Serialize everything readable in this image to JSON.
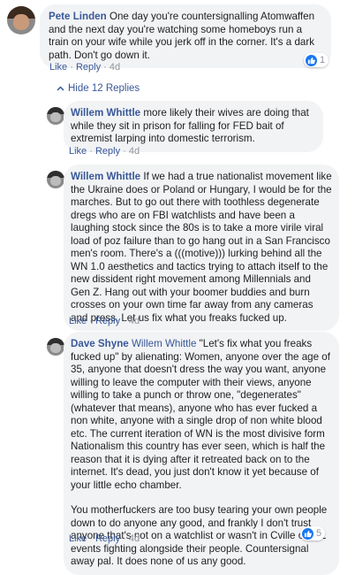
{
  "comments": [
    {
      "name": "Pete Linden",
      "text": "One day you're countersignalling Atomwaffen and the next day you're watching some homeboys run a train on your wife while you jerk off in the corner. It's a dark path. Don't go down it.",
      "like": "Like",
      "reply": "Reply",
      "time": "4d",
      "reactions": "1"
    },
    {
      "name": "Willem Whittle",
      "text": "more likely their wives are doing that while they sit in prison for falling for FED bait of extremist larping into domestic terrorism.",
      "like": "Like",
      "reply": "Reply",
      "time": "4d"
    },
    {
      "name": "Willem Whittle",
      "text": "If we had a true nationalist movement like the Ukraine does or Poland or Hungary, I would be for the marches. But to go out there with toothless degenerate dregs who are on FBI watchlists and have been a laughing stock since the 80s is to take a more virile viral load of poz failure than to go hang out in a San Francisco men's room. There's a (((motive))) lurking behind all the WN 1.0 aesthetics and tactics trying to attach itself to the new dissident right movement among Millennials and Gen Z. Hang out with your boomer buddies and burn crosses on your own time far away from any cameras and press. Let us fix what you freaks fucked up.",
      "like": "Like",
      "reply": "Reply",
      "time": "4d"
    },
    {
      "name": "Dave Shyne",
      "mention": "Willem Whittle",
      "text": "\"Let's fix what you freaks fucked up\" by alienating: Women, anyone over the age of 35, anyone that doesn't dress the way you want, anyone willing to leave the computer with their views, anyone willing to take a punch or throw one, \"degenerates\" (whatever that means), anyone who has ever fucked a non white, anyone with a single drop of non white blood etc. The current iteration of WN is the most divisive form Nationalism this country has ever seen, which is half the reason that it is dying after it retreated back on to the internet. It's dead, you just don't know it yet because of your little echo chamber.",
      "text2": "You motherfuckers are too busy tearing your own people down to do anyone any good, and frankly I don't trust anyone that's not on a watchlist or wasn't in Cville or IRL events fighting alongside their people. Countersignal away pal. It does none of us any good.",
      "like": "Like",
      "reply": "Reply",
      "time": "4d",
      "reactions": "5"
    }
  ],
  "hide_replies": "Hide 12 Replies",
  "colors": {
    "link": "#385898",
    "bubble": "#f2f3f5",
    "like_blue": "#1877f2"
  },
  "icons": {
    "like": "thumbs-up-icon",
    "collapse": "chevron-up-icon"
  }
}
